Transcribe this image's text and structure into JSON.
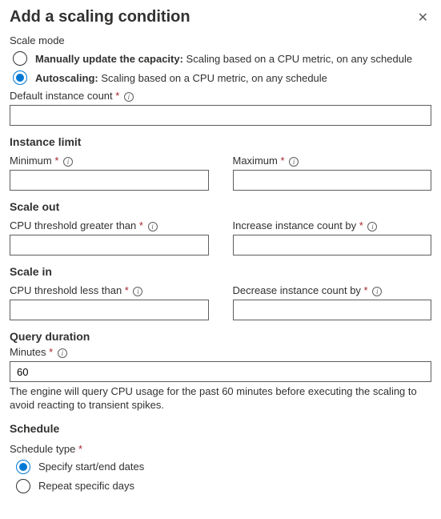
{
  "header": {
    "title": "Add a scaling condition"
  },
  "scaleMode": {
    "label": "Scale mode",
    "manual": {
      "bold": "Manually update the capacity:",
      "rest": " Scaling based on a CPU metric, on any schedule"
    },
    "auto": {
      "bold": "Autoscaling:",
      "rest": " Scaling based on a CPU metric, on any schedule"
    }
  },
  "defaultInstance": {
    "label": "Default instance count",
    "value": ""
  },
  "instanceLimit": {
    "heading": "Instance limit",
    "min": {
      "label": "Minimum",
      "value": ""
    },
    "max": {
      "label": "Maximum",
      "value": ""
    }
  },
  "scaleOut": {
    "heading": "Scale out",
    "threshold": {
      "label": "CPU threshold greater than",
      "value": ""
    },
    "increase": {
      "label": "Increase instance count by",
      "value": ""
    }
  },
  "scaleIn": {
    "heading": "Scale in",
    "threshold": {
      "label": "CPU threshold less than",
      "value": ""
    },
    "decrease": {
      "label": "Decrease instance count by",
      "value": ""
    }
  },
  "queryDuration": {
    "heading": "Query duration",
    "minutes": {
      "label": "Minutes",
      "value": "60"
    },
    "help": "The engine will query CPU usage for the past 60 minutes before executing the scaling to avoid reacting to transient spikes."
  },
  "schedule": {
    "heading": "Schedule",
    "typeLabel": "Schedule type",
    "specify": "Specify start/end dates",
    "repeat": "Repeat specific days"
  },
  "glyph": {
    "star": " *",
    "i": "i"
  }
}
